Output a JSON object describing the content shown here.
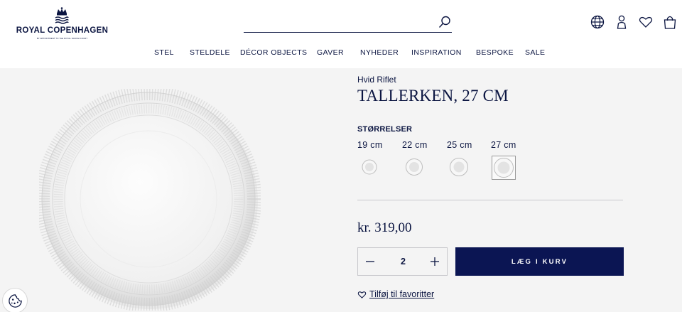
{
  "header": {
    "logo": {
      "name": "ROYAL COPENHAGEN",
      "tagline": "BY APPOINTMENT TO THE ROYAL DANISH COURT"
    },
    "search": {
      "value": "",
      "placeholder": ""
    },
    "icons": [
      "globe-icon",
      "account-icon",
      "heart-icon",
      "bag-icon"
    ]
  },
  "nav": {
    "items": [
      {
        "label": "STEL"
      },
      {
        "label": "STELDELE"
      },
      {
        "label": "DÉCOR OBJECTS"
      },
      {
        "label": "GAVER"
      },
      {
        "label": "NYHEDER"
      },
      {
        "label": "INSPIRATION"
      },
      {
        "label": "BESPOKE"
      },
      {
        "label": "SALE"
      }
    ]
  },
  "product": {
    "collection": "Hvid Riflet",
    "title": "TALLERKEN, 27 CM",
    "sizes_label": "STØRRELSER",
    "sizes": [
      {
        "label": "19 cm",
        "selected": false
      },
      {
        "label": "22 cm",
        "selected": false
      },
      {
        "label": "25 cm",
        "selected": false
      },
      {
        "label": "27 cm",
        "selected": true
      }
    ],
    "price": "kr. 319,00",
    "quantity": "2",
    "add_to_cart_label": "LÆG I KURV",
    "favorite_label": "Tilføj til favoritter"
  },
  "colors": {
    "brand_navy": "#0b1553",
    "background": "#f4f4f4",
    "header_bg": "#ffffff"
  }
}
